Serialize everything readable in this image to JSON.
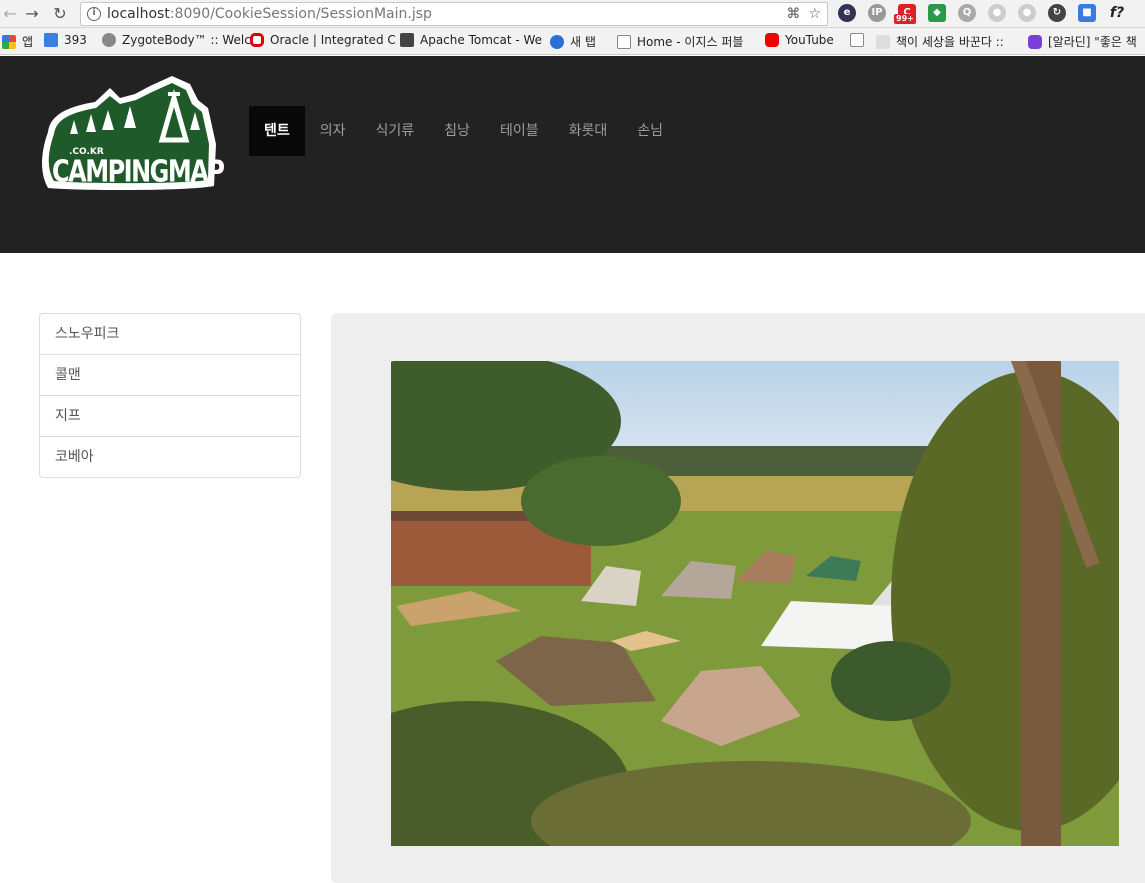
{
  "browser": {
    "url_host": "localhost",
    "url_path": ":8090/CookieSession/SessionMain.jsp",
    "extension_badge": "99+",
    "bookmarks": [
      {
        "label": "앱",
        "color": "#e44"
      },
      {
        "label": "393",
        "color": "#3b7de0"
      },
      {
        "label": "ZygoteBody™ :: Welc",
        "color": "#888"
      },
      {
        "label": "Oracle | Integrated C",
        "color": "#d00"
      },
      {
        "label": "Apache Tomcat - We",
        "color": "#444"
      },
      {
        "label": "새 탭",
        "color": "#2a6fd6"
      },
      {
        "label": "Home - 이지스 퍼블",
        "color": "#bbb"
      },
      {
        "label": "YouTube",
        "color": "#e00"
      },
      {
        "label": "책이 세상을 바꾼다 ::",
        "color": "#ddd"
      },
      {
        "label": "[알라딘] \"좋은 책",
        "color": "#7a3fd6"
      }
    ]
  },
  "header": {
    "logo_sub": ".CO.KR",
    "logo_text": "CAMPINGMAP",
    "menu": [
      "텐트",
      "의자",
      "식기류",
      "침낭",
      "테이블",
      "화롯대",
      "손님"
    ]
  },
  "sidebar": {
    "items": [
      "스노우피크",
      "콜맨",
      "지프",
      "코베아"
    ]
  },
  "colors": {
    "header_bg": "#222222",
    "logo_green": "#1f5a2a"
  }
}
